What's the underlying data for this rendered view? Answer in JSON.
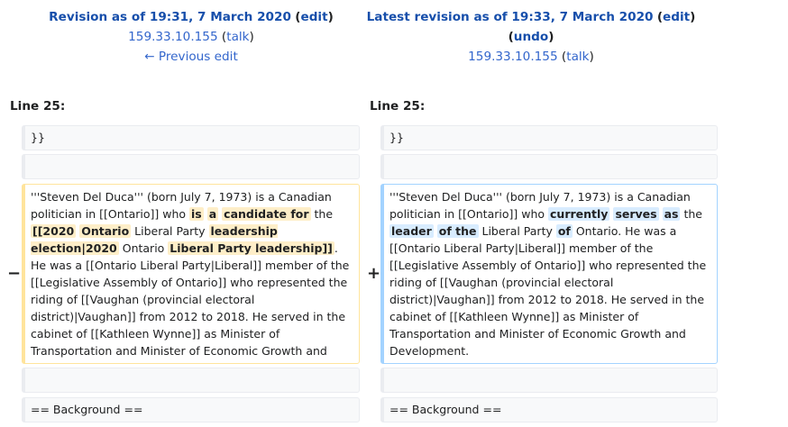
{
  "left_header": {
    "title": "Revision as of 19:31, 7 March 2020",
    "edit": "edit",
    "user": "159.33.10.155",
    "talk": "talk",
    "prev": "← Previous edit"
  },
  "right_header": {
    "title": "Latest revision as of 19:33, 7 March 2020",
    "edit": "edit",
    "undo": "undo",
    "user": "159.33.10.155",
    "talk": "talk"
  },
  "diff": {
    "line_label_left": "Line 25:",
    "line_label_right": "Line 25:",
    "context_1": "}}",
    "context_2": "",
    "context_3": "",
    "context_4": "== Background ==",
    "minus": "−",
    "plus": "+",
    "left_parts": [
      {
        "t": "'''Steven Del Duca''' (born July 7, 1973) is a Canadian politician in [[Ontario]] who "
      },
      {
        "t": "is",
        "hl": true
      },
      {
        "t": " "
      },
      {
        "t": "a",
        "hl": true
      },
      {
        "t": " "
      },
      {
        "t": "candidate for",
        "hl": true
      },
      {
        "t": " the "
      },
      {
        "t": "[[2020",
        "hl": true
      },
      {
        "t": " "
      },
      {
        "t": "Ontario",
        "hl": true
      },
      {
        "t": " Liberal Party "
      },
      {
        "t": "leadership election|2020",
        "hl": true
      },
      {
        "t": " Ontario "
      },
      {
        "t": "Liberal Party leadership]]",
        "hl": true
      },
      {
        "t": ". He was a [[Ontario Liberal Party|Liberal]] member of the [[Legislative Assembly of Ontario]] who represented the riding of [[Vaughan (provincial electoral district)|Vaughan]] from 2012 to 2018. He served in the cabinet of [[Kathleen Wynne]] as Minister of Transportation and Minister of Economic Growth and Development."
      }
    ],
    "right_parts": [
      {
        "t": "'''Steven Del Duca''' (born July 7, 1973) is a Canadian politician in [[Ontario]] who "
      },
      {
        "t": "currently",
        "hl": true
      },
      {
        "t": " "
      },
      {
        "t": "serves",
        "hl": true
      },
      {
        "t": " "
      },
      {
        "t": "as",
        "hl": true
      },
      {
        "t": " the "
      },
      {
        "t": "leader",
        "hl": true
      },
      {
        "t": " "
      },
      {
        "t": "of the",
        "hl": true
      },
      {
        "t": " Liberal Party "
      },
      {
        "t": "of",
        "hl": true
      },
      {
        "t": " Ontario. He was a [[Ontario Liberal Party|Liberal]] member of the [[Legislative Assembly of Ontario]] who represented the riding of [[Vaughan (provincial electoral district)|Vaughan]] from 2012 to 2018. He served in the cabinet of [[Kathleen Wynne]] as Minister of Transportation and Minister of Economic Growth and Development."
      }
    ]
  },
  "colors": {
    "link": "#3366cc",
    "deleted_border": "#ffe49c",
    "deleted_highlight": "#feeec8",
    "added_border": "#a3d3ff",
    "added_highlight": "#d8ecff"
  }
}
